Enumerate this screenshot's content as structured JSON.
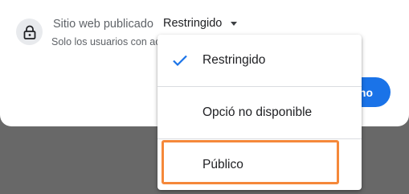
{
  "setting": {
    "label": "Sitio web publicado",
    "current_value": "Restringido",
    "description": "Solo los usuarios con ac",
    "icon": "lock-icon"
  },
  "primary_button": {
    "label": "no"
  },
  "menu": {
    "items": [
      {
        "label": "Restringido",
        "selected": true,
        "icon": "check-icon"
      },
      {
        "label": "Opció no disponible",
        "selected": false
      },
      {
        "label": "Público",
        "selected": false
      }
    ]
  },
  "colors": {
    "backdrop": "#686868",
    "accent": "#1a73e8",
    "highlight": "#f5883a"
  }
}
